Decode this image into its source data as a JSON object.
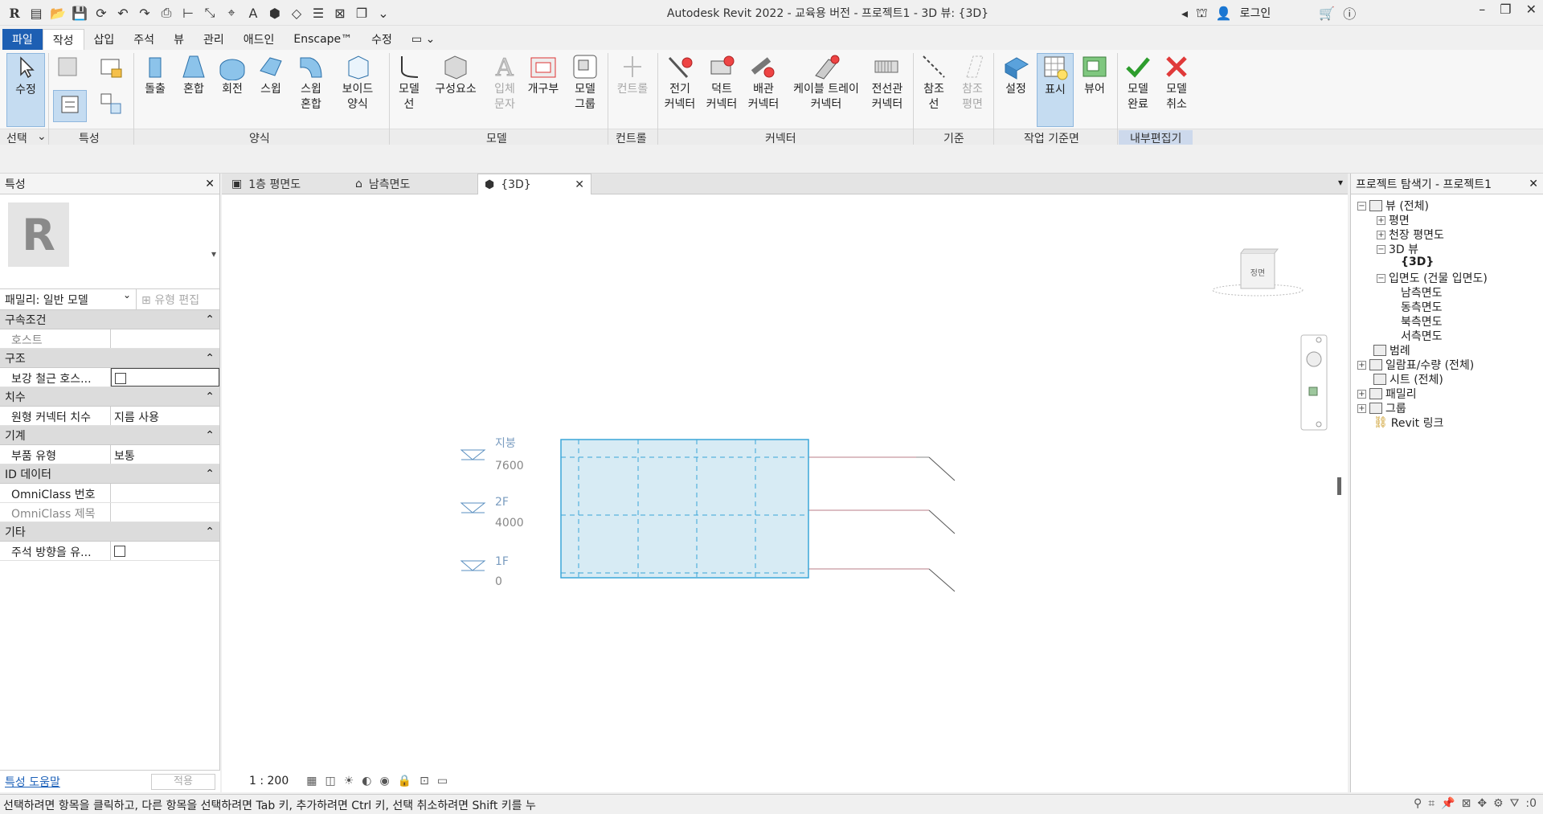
{
  "window": {
    "title": "Autodesk Revit 2022 - 교육용 버전 - 프로젝트1 - 3D 뷰: {3D}",
    "login_label": "로그인"
  },
  "tabs": [
    "파일",
    "작성",
    "삽입",
    "주석",
    "뷰",
    "관리",
    "애드인",
    "Enscape™",
    "수정"
  ],
  "ribbon": {
    "select_tool": "수정",
    "select_panel": "선택",
    "properties_panel": "특성",
    "forms_panel": "양식",
    "forms_tools": [
      "돌출",
      "혼합",
      "회전",
      "스윕",
      "스윕\n혼합",
      "보이드\n양식"
    ],
    "model_panel": "모델",
    "model_tools": [
      "모델\n선",
      "구성요소",
      "입체\n문자",
      "개구부",
      "모델\n그룹"
    ],
    "control_panel": "컨트롤",
    "control_tool": "컨트롤",
    "connector_panel": "커넥터",
    "connector_tools": [
      "전기\n커넥터",
      "덕트\n커넥터",
      "배관\n커넥터",
      "케이블 트레이\n커넥터",
      "전선관\n커넥터"
    ],
    "datum_panel": "기준",
    "datum_tools": [
      "참조\n선",
      "참조\n평면"
    ],
    "workplane_panel": "작업 기준면",
    "workplane_tools": [
      "설정",
      "표시",
      "뷰어"
    ],
    "editor_panel": "내부편집기",
    "editor_tools": [
      "모델\n완료",
      "모델\n취소"
    ]
  },
  "properties": {
    "title": "특성",
    "family_select": "패밀리: 일반 모델",
    "edit_type": "유형 편집",
    "categories": [
      {
        "name": "구속조건",
        "rows": [
          {
            "k": "호스트",
            "v": "",
            "dim": true
          }
        ]
      },
      {
        "name": "구조",
        "rows": [
          {
            "k": "보강 철근 호스...",
            "v": "",
            "checkbox": true
          }
        ]
      },
      {
        "name": "치수",
        "rows": [
          {
            "k": "원형 커넥터 치수",
            "v": "지름 사용"
          }
        ]
      },
      {
        "name": "기계",
        "rows": [
          {
            "k": "부품 유형",
            "v": "보통"
          }
        ]
      },
      {
        "name": "ID 데이터",
        "rows": [
          {
            "k": "OmniClass 번호",
            "v": ""
          },
          {
            "k": "OmniClass 제목",
            "v": "",
            "dim": true
          }
        ]
      },
      {
        "name": "기타",
        "rows": [
          {
            "k": "주석 방향을 유...",
            "v": "",
            "checkbox": true
          }
        ]
      }
    ],
    "help_link": "특성 도움말",
    "apply_button": "적용"
  },
  "view_tabs": [
    "1층 평면도",
    "남측면도",
    "{3D}"
  ],
  "viewcube_label": "정면",
  "levels": [
    {
      "name": "지붕",
      "elevation": "7600"
    },
    {
      "name": "2F",
      "elevation": "4000"
    },
    {
      "name": "1F",
      "elevation": "0"
    }
  ],
  "view_scale": "1 : 200",
  "browser": {
    "title": "프로젝트 탐색기 - 프로젝트1",
    "nodes": [
      "뷰 (전체)",
      "평면",
      "천장 평면도",
      "3D 뷰",
      "{3D}",
      "입면도 (건물 입면도)",
      "남측면도",
      "동측면도",
      "북측면도",
      "서측면도",
      "범례",
      "일람표/수량 (전체)",
      "시트 (전체)",
      "패밀리",
      "그룹",
      "Revit 링크"
    ]
  },
  "status_text": "선택하려면 항목을 클릭하고, 다른 항목을 선택하려면 Tab 키, 추가하려면 Ctrl 키, 선택 취소하려면 Shift 키를 누",
  "filter_count": ":0",
  "colors": {
    "file_tab": "#1d5fb3",
    "selection_fill": "#d7ebf4",
    "selection_stroke": "#3aa6d8",
    "level_line": "#b97c87"
  }
}
